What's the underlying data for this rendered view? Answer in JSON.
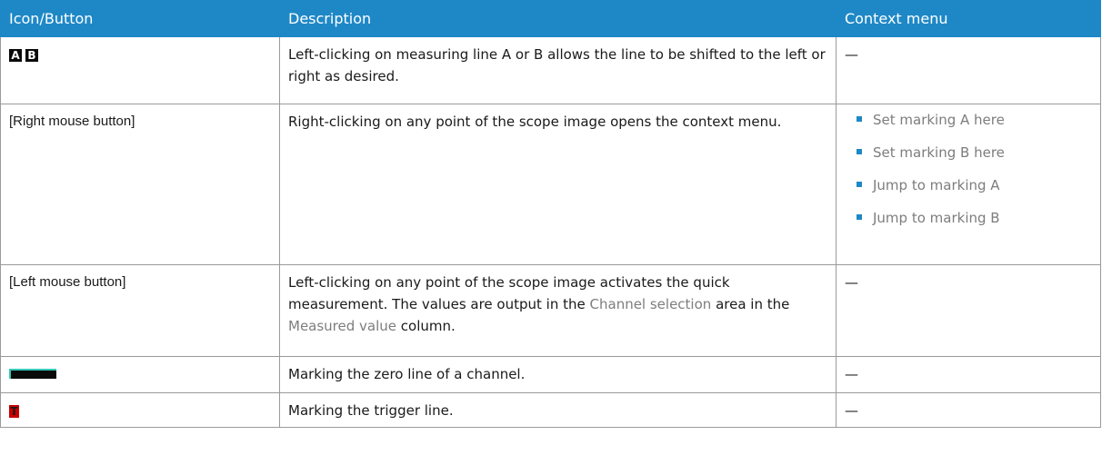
{
  "table": {
    "headers": [
      "Icon/Button",
      "Description",
      "Context menu"
    ],
    "rows": [
      {
        "icon_name": "measuring-line-ab-icons",
        "icon_glyphs": [
          "A",
          "B"
        ],
        "description": "Left-clicking on measuring line A or B allows the line to be shifted to the left or right as desired.",
        "context": "—"
      },
      {
        "button": "[Right mouse button]",
        "description": "Right-clicking on any point of the scope image opens the context menu.",
        "context_menu": [
          "Set marking A here",
          "Set marking B here",
          "Jump to marking A",
          "Jump to marking B"
        ]
      },
      {
        "button": "[Left mouse button]",
        "description_parts": {
          "p1": "Left-clicking on any point of the scope image activates the quick measurement. The values are output in the ",
          "link1": "Channel selection",
          "p2": " area in the ",
          "link2": "Measured value",
          "p3": " column."
        },
        "context": "—"
      },
      {
        "icon_name": "zero-line-marker-icon",
        "description": "Marking the zero line of a channel.",
        "context": "—"
      },
      {
        "icon_name": "trigger-line-marker-icon",
        "icon_glyph": "T",
        "description": "Marking the trigger line.",
        "context": "—"
      }
    ]
  },
  "colors": {
    "header_bg": "#1e88c7",
    "bullet": "#1e88c7",
    "link_text": "#7d7d7d",
    "zero_line": "#35c9b8",
    "trigger_red": "#c80000"
  }
}
